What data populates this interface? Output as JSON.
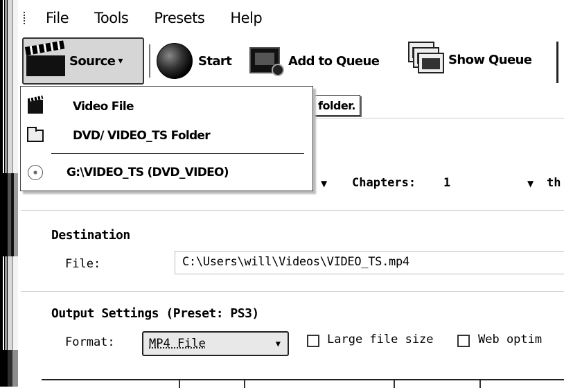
{
  "menubar": {
    "items": [
      "File",
      "Tools",
      "Presets",
      "Help"
    ]
  },
  "toolbar": {
    "source_label": "Source",
    "source_arrow": "▾",
    "start_label": "Start",
    "add_queue_label": "Add to Queue",
    "show_queue_label": "Show Queue"
  },
  "source_menu": {
    "items": [
      {
        "label": "Video File",
        "icon": "clapperboard-icon"
      },
      {
        "label": "DVD/ VIDEO_TS Folder",
        "icon": "folder-open-icon"
      },
      {
        "label": "G:\\VIDEO_TS (DVD_VIDEO)",
        "icon": "disc-icon"
      }
    ]
  },
  "tooltip_fragment": "folder.",
  "source_row": {
    "chapters_label": "Chapters:",
    "chapters_value": "1",
    "through_fragment": "th",
    "dropdown_arrow": "▼"
  },
  "destination": {
    "title": "Destination",
    "file_label": "File:",
    "file_value": "C:\\Users\\will\\Videos\\VIDEO_TS.mp4"
  },
  "output_settings": {
    "title": "Output Settings (Preset: PS3)",
    "format_label": "Format:",
    "format_value": "MP4 File",
    "large_file_label": "Large file size",
    "web_optimized_label": "Web optim",
    "large_file_checked": false,
    "web_optimized_checked": false
  }
}
